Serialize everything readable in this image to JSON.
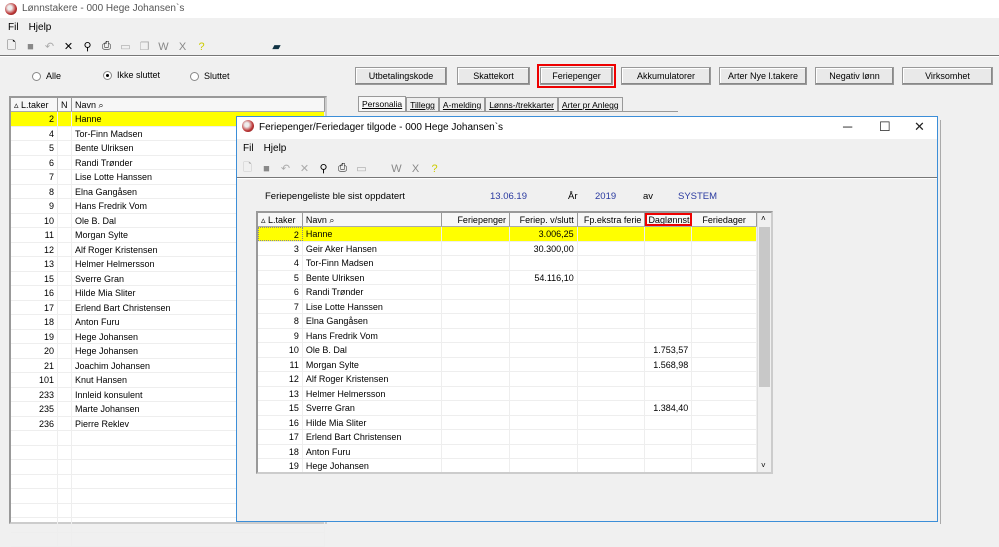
{
  "window": {
    "title": "Lønnstakere - 000 Hege Johansen`s",
    "menu": [
      "Fil",
      "Hjelp"
    ]
  },
  "toolbar_icons": [
    "new-icon",
    "save-icon",
    "undo-icon",
    "delete-icon",
    "find-icon",
    "print-icon",
    "form-icon",
    "copy-icon",
    "word-icon",
    "excel-icon",
    "help-icon",
    "book-icon"
  ],
  "filters": [
    {
      "label": "Alle",
      "checked": false
    },
    {
      "label": "Ikke sluttet",
      "checked": true
    },
    {
      "label": "Sluttet",
      "checked": false
    }
  ],
  "buttons": [
    "Utbetalingskode",
    "Skattekort",
    "Feriepenger",
    "Akkumulatorer",
    "Arter Nye l.takere",
    "Negativ lønn",
    "Virksomhet"
  ],
  "tabs": [
    "Personalia",
    "Tillegg",
    "A-melding",
    "Lønns-/trekkarter",
    "Arter pr Anlegg"
  ],
  "left_table": {
    "headers": [
      "L.taker",
      "N",
      "Navn"
    ],
    "rows": [
      [
        "2",
        "Hanne"
      ],
      [
        "4",
        "Tor-Finn Madsen"
      ],
      [
        "5",
        "Bente Ulriksen"
      ],
      [
        "6",
        "Randi Trønder"
      ],
      [
        "7",
        "Lise Lotte Hanssen"
      ],
      [
        "8",
        "Elna Gangåsen"
      ],
      [
        "9",
        "Hans Fredrik Vom"
      ],
      [
        "10",
        "Ole B. Dal"
      ],
      [
        "11",
        "Morgan Sylte"
      ],
      [
        "12",
        "Alf Roger Kristensen"
      ],
      [
        "13",
        "Helmer Helmersson"
      ],
      [
        "15",
        "Sverre Gran"
      ],
      [
        "16",
        "Hilde Mia Sliter"
      ],
      [
        "17",
        "Erlend Bart Christensen"
      ],
      [
        "18",
        "Anton Furu"
      ],
      [
        "19",
        "Hege Johansen"
      ],
      [
        "20",
        "Hege Johansen"
      ],
      [
        "21",
        "Joachim Johansen"
      ],
      [
        "101",
        "Knut Hansen"
      ],
      [
        "233",
        "Innleid konsulent"
      ],
      [
        "235",
        "Marte Johansen"
      ],
      [
        "236",
        "Pierre Reklev"
      ]
    ]
  },
  "dialog": {
    "title": "Feriepenger/Feriedager tilgode - 000 Hege Johansen`s",
    "menu": [
      "Fil",
      "Hjelp"
    ],
    "info": {
      "label": "Feriepengeliste ble sist oppdatert",
      "date": "13.06.19",
      "year_label": "År",
      "year": "2019",
      "by_label": "av",
      "by": "SYSTEM"
    },
    "headers": [
      "L.taker",
      "Navn",
      "Feriepenger",
      "Feriep. v/slutt",
      "Fp.ekstra ferie",
      "Daglønnstr",
      "Feriedager"
    ],
    "rows": [
      [
        "2",
        "Hanne",
        "",
        "3.006,25",
        "",
        "",
        ""
      ],
      [
        "3",
        "Geir Aker Hansen",
        "",
        "30.300,00",
        "",
        "",
        ""
      ],
      [
        "4",
        "Tor-Finn Madsen",
        "",
        "",
        "",
        "",
        ""
      ],
      [
        "5",
        "Bente Ulriksen",
        "",
        "54.116,10",
        "",
        "",
        ""
      ],
      [
        "6",
        "Randi Trønder",
        "",
        "",
        "",
        "",
        ""
      ],
      [
        "7",
        "Lise Lotte Hanssen",
        "",
        "",
        "",
        "",
        ""
      ],
      [
        "8",
        "Elna Gangåsen",
        "",
        "",
        "",
        "",
        ""
      ],
      [
        "9",
        "Hans Fredrik Vom",
        "",
        "",
        "",
        "",
        ""
      ],
      [
        "10",
        "Ole B. Dal",
        "",
        "",
        "",
        "1.753,57",
        ""
      ],
      [
        "11",
        "Morgan Sylte",
        "",
        "",
        "",
        "1.568,98",
        ""
      ],
      [
        "12",
        "Alf Roger Kristensen",
        "",
        "",
        "",
        "",
        ""
      ],
      [
        "13",
        "Helmer Helmersson",
        "",
        "",
        "",
        "",
        ""
      ],
      [
        "15",
        "Sverre Gran",
        "",
        "",
        "",
        "1.384,40",
        ""
      ],
      [
        "16",
        "Hilde Mia Sliter",
        "",
        "",
        "",
        "",
        ""
      ],
      [
        "17",
        "Erlend Bart Christensen",
        "",
        "",
        "",
        "",
        ""
      ],
      [
        "18",
        "Anton Furu",
        "",
        "",
        "",
        "",
        ""
      ],
      [
        "19",
        "Hege Johansen",
        "",
        "",
        "",
        "",
        ""
      ]
    ]
  },
  "colors": {
    "selected_row": "#ffff00",
    "highlight": "#e00000",
    "info_value": "#2a3aa0"
  }
}
